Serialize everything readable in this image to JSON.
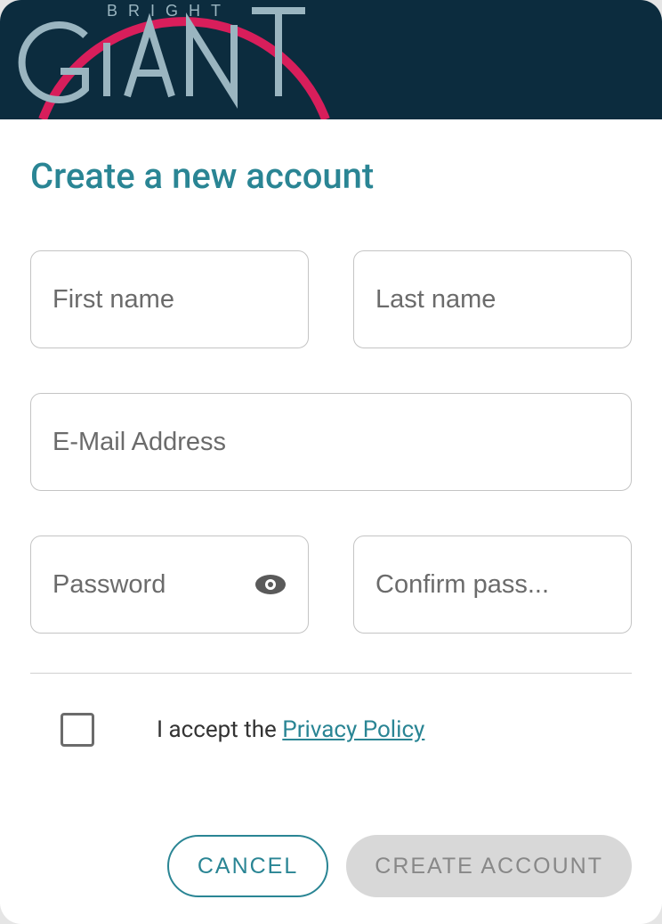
{
  "header": {
    "brand_top": "BRIGHT",
    "brand_bottom": "GIANT"
  },
  "page": {
    "title": "Create a new account"
  },
  "form": {
    "first_name": {
      "placeholder": "First name",
      "value": ""
    },
    "last_name": {
      "placeholder": "Last name",
      "value": ""
    },
    "email": {
      "placeholder": "E-Mail Address",
      "value": ""
    },
    "password": {
      "placeholder": "Password",
      "value": ""
    },
    "confirm_password": {
      "placeholder": "Confirm pass...",
      "value": ""
    }
  },
  "privacy": {
    "prefix": "I accept the ",
    "link": "Privacy Policy",
    "accepted": false
  },
  "buttons": {
    "cancel": "CANCEL",
    "create": "CREATE ACCOUNT"
  },
  "colors": {
    "header_bg": "#0c2c3e",
    "accent": "#2a8594",
    "logo_arc": "#d81e5b"
  }
}
